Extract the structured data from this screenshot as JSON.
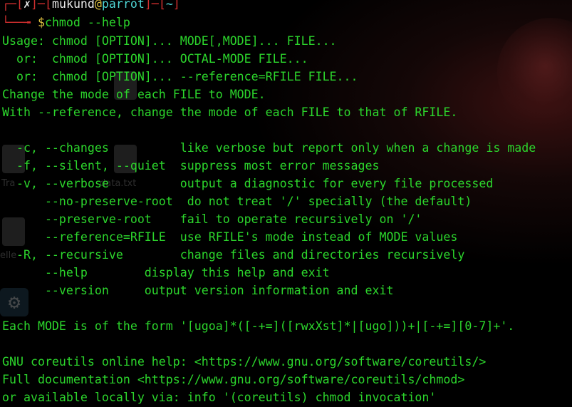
{
  "prompt": {
    "open_bracket": "┌─[",
    "status": "✗",
    "mid_bracket": "]─[",
    "user": "mukund",
    "at": "@",
    "host": "parrot",
    "dir_open": "]─[",
    "dir": "~",
    "dir_close": "]",
    "arrow": "└──╼ ",
    "dollar": "$",
    "command": "chmod --help"
  },
  "output_lines": [
    "Usage: chmod [OPTION]... MODE[,MODE]... FILE...",
    "  or:  chmod [OPTION]... OCTAL-MODE FILE...",
    "  or:  chmod [OPTION]... --reference=RFILE FILE...",
    "Change the mode of each FILE to MODE.",
    "With --reference, change the mode of each FILE to that of RFILE.",
    "",
    "  -c, --changes          like verbose but report only when a change is made",
    "  -f, --silent, --quiet  suppress most error messages",
    "  -v, --verbose          output a diagnostic for every file processed",
    "      --no-preserve-root  do not treat '/' specially (the default)",
    "      --preserve-root    fail to operate recursively on '/'",
    "      --reference=RFILE  use RFILE's mode instead of MODE values",
    "  -R, --recursive        change files and directories recursively",
    "      --help        display this help and exit",
    "      --version     output version information and exit",
    "",
    "Each MODE is of the form '[ugoa]*([-+=]([rwxXst]*|[ugo]))+|[-+=][0-7]+'.",
    "",
    "GNU coreutils online help: <https://www.gnu.org/software/coreutils/>",
    "Full documentation <https://www.gnu.org/software/coreutils/chmod>",
    "or available locally via: info '(coreutils) chmod invocation'"
  ],
  "desktop_ghosts": {
    "label_1": "Tra",
    "label_2": "data.txt",
    "label_3": "elle",
    "gear_icon": "gear-icon",
    "file_icon": "file-icon"
  },
  "colors": {
    "text": "#2cd62c",
    "bracket": "#d22f2f",
    "host": "#4fd6d6",
    "dollar": "#e0c341",
    "background": "#000000"
  }
}
